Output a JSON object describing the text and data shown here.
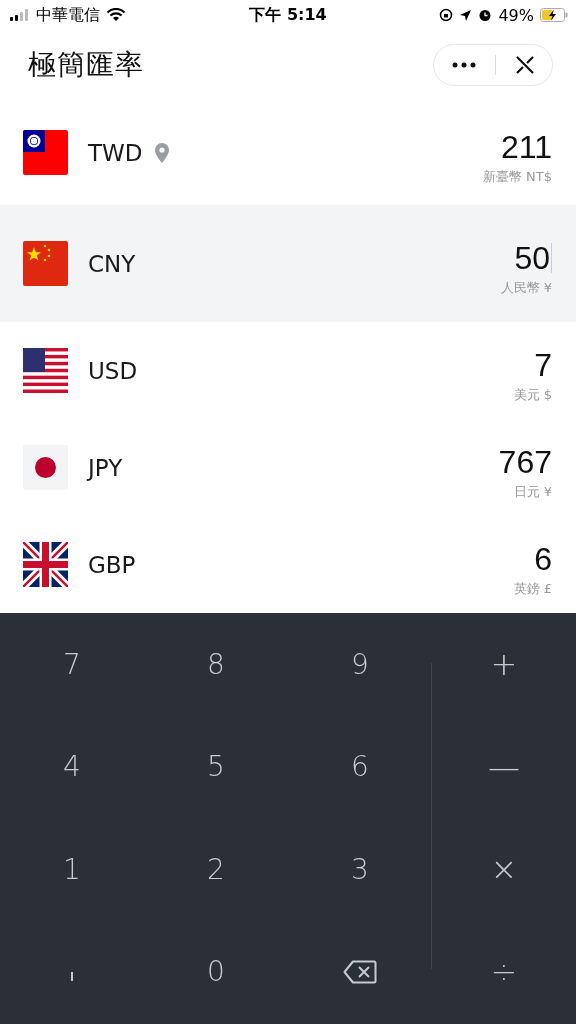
{
  "status_bar": {
    "carrier": "中華電信",
    "time": "下午 5:14",
    "battery": "49%"
  },
  "header": {
    "title": "極簡匯率"
  },
  "currencies": [
    {
      "kind": "tw",
      "code": "TWD",
      "located": true,
      "amount": "211",
      "name": "新臺幣 NT$",
      "selected": false
    },
    {
      "kind": "cn",
      "code": "CNY",
      "located": false,
      "amount": "50",
      "name": "人民幣 ¥",
      "selected": true
    },
    {
      "kind": "us",
      "code": "USD",
      "located": false,
      "amount": "7",
      "name": "美元 $",
      "selected": false
    },
    {
      "kind": "jp",
      "code": "JPY",
      "located": false,
      "amount": "767",
      "name": "日元 ¥",
      "selected": false
    },
    {
      "kind": "gb",
      "code": "GBP",
      "located": false,
      "amount": "6",
      "name": "英鎊 £",
      "selected": false
    }
  ],
  "keypad": [
    {
      "kind": "digit",
      "label": "7"
    },
    {
      "kind": "digit",
      "label": "8"
    },
    {
      "kind": "digit",
      "label": "9"
    },
    {
      "kind": "operator",
      "label": "+"
    },
    {
      "kind": "digit",
      "label": "4"
    },
    {
      "kind": "digit",
      "label": "5"
    },
    {
      "kind": "digit",
      "label": "6"
    },
    {
      "kind": "operator",
      "label": "—"
    },
    {
      "kind": "digit",
      "label": "1"
    },
    {
      "kind": "digit",
      "label": "2"
    },
    {
      "kind": "digit",
      "label": "3"
    },
    {
      "kind": "operator",
      "label": "×"
    },
    {
      "kind": "decimal"
    },
    {
      "kind": "digit",
      "label": "0"
    },
    {
      "kind": "backspace"
    },
    {
      "kind": "operator",
      "label": "÷"
    }
  ]
}
